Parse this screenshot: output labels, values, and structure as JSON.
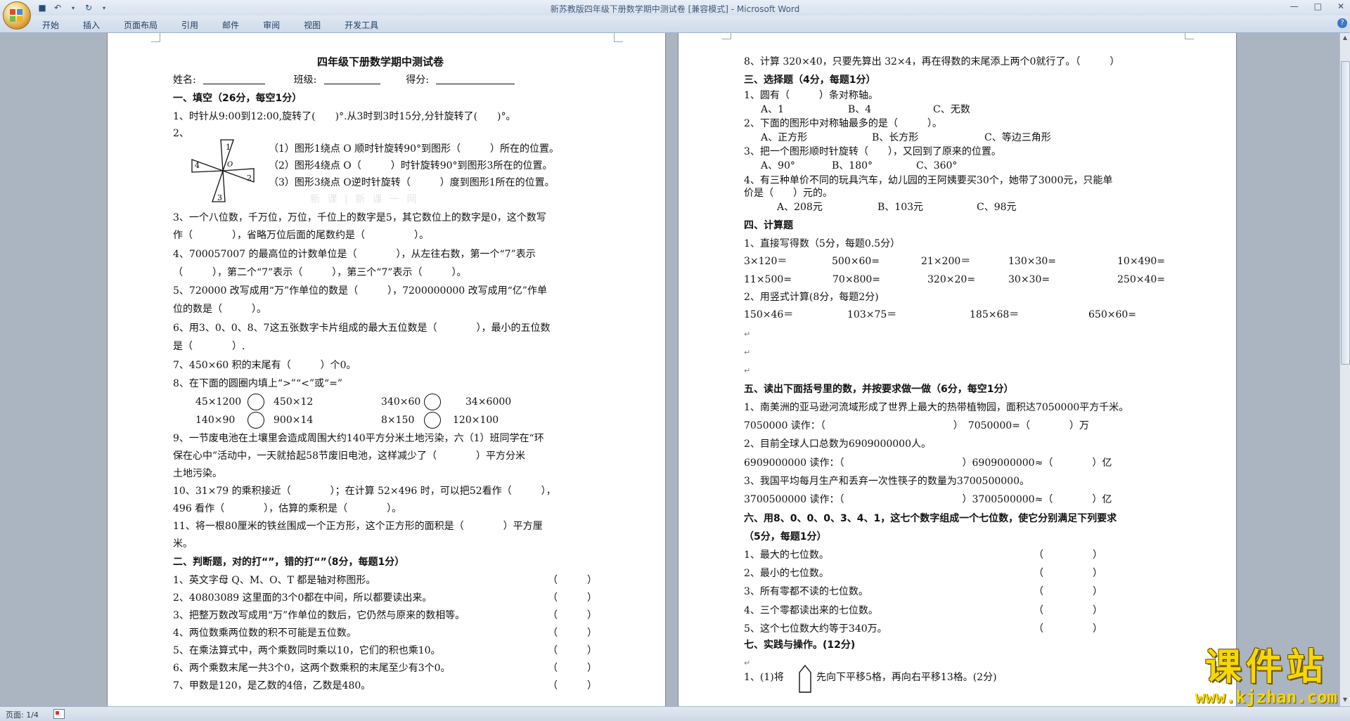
{
  "window": {
    "title": "新苏教版四年级下册数学期中测试卷 [兼容模式] - Microsoft Word",
    "tabs": [
      "开始",
      "插入",
      "页面布局",
      "引用",
      "邮件",
      "审阅",
      "视图",
      "开发工具"
    ]
  },
  "status": {
    "page": "页面: 1/4"
  },
  "left": {
    "title": "四年级下册数学期中测试卷",
    "name_label": "姓名:",
    "class_label": "班级:",
    "score_label": "得分:",
    "sec1": "一、填空（26分，每空1分）",
    "q1": "1、时针从9:00到12:00,旋转了(　　)°.从3时到3时15分,分针旋转了(　　)°。",
    "q2": "2、",
    "q2a": "（1）图形1绕点 O 顺时针旋转90°到图形（　　　）所在的位置。",
    "q2b": "（2）图形4绕点 O（　　　）时针旋转90°到图形3所在的位置。",
    "q2c": "（3）图形3绕点 O逆时针旋转（　　　）度到图形1所在的位置。",
    "fig_labels": [
      "1",
      "2",
      "3",
      "4",
      "O"
    ],
    "q3a": "3、一个八位数，千万位，万位，千位上的数字是5，其它数位上的数字是0，这个数写",
    "q3b": "作（　　　　），省略万位后面的尾数约是（　　　　　）。",
    "q4a": "4、700057007 的最高位的计数单位是（　　　　），从左往右数，第一个“7”表示",
    "q4b": "（　　　），第二个“7”表示（　　　），第三个“7”表示（　　　）。",
    "q5a": "5、720000 改写成用“万”作单位的数是（　　　），7200000000 改写成用“亿”作单",
    "q5b": "位的数是（　　　）。",
    "q6a": "6、用3、0、0、8、7这五张数字卡片组成的最大五位数是（　　　　），最小的五位数",
    "q6b": "是（　　　　）.",
    "q7": "7、450×60 积的末尾有（　　　）个0。",
    "q8": "8、在下面的圆圈内填上“>”“<”或“=”",
    "cmp": [
      "45×1200",
      "450×12",
      "340×60",
      "34×6000",
      "140×90",
      "900×14",
      "8×150",
      "120×100"
    ],
    "q9a": "9、一节废电池在土壤里会造成周围大约140平方分米土地污染，六（1）班同学在“环",
    "q9b": "保在心中”活动中，一天就拾起58节废旧电池，这样减少了（　　　　）平方分米",
    "q9c": "土地污染。",
    "q10a": "10、31×79 的乘积接近（　　　　）；在计算 52×496 时，可以把52看作（　　　），",
    "q10b": "496 看作（　　　　），估算的乘积是（　　　　）。",
    "q11a": "11、将一根80厘米的铁丝围成一个正方形，这个正方形的面积是（　　　　）平方厘",
    "q11b": "米。",
    "sec2": "二、判断题，对的打“”，错的打“”（8分，每题1分）",
    "j1": "1、英文字母 Q、M、O、T 都是轴对称图形。",
    "j2": "2、40803089 这里面的3个0都在中间，所以都要读出来。",
    "j3": "3、把整万数改写成用“万”作单位的数后，它仍然与原来的数相等。",
    "j4": "4、两位数乘两位数的积不可能是五位数。",
    "j5": "5、在乘法算式中，两个乘数同时乘以10，它们的积也乘10。",
    "j6": "6、两个乘数末尾一共3个0，这两个数乘积的末尾至少有3个0。",
    "j7": "7、甲数是120，是乙数的4倍，乙数是480。",
    "paren": "（　　　）",
    "faint": "新 课 | 新 课 一 网"
  },
  "right": {
    "j8": "8、计算 320×40，只要先算出 32×4，再在得数的末尾添上两个0就行了。（　　　）",
    "sec3": "三、选择题（4分，每题1分）",
    "c1": "1、圆有（　　　）条对称轴。",
    "c1o": [
      "A、1",
      "B、4",
      "C、无数"
    ],
    "c2": "2、下面的图形中对称轴最多的是（　　　）。",
    "c2o": [
      "A、正方形",
      "B、长方形",
      "C、等边三角形"
    ],
    "c3": "3、把一个图形顺时针旋转（　　），又回到了原来的位置。",
    "c3o": [
      "A、90°",
      "B、180°",
      "C、360°"
    ],
    "c4a": "4、有三种单价不同的玩具汽车，幼儿园的王阿姨要买30个，她带了3000元，只能单",
    "c4b": "价是（　　）元的。",
    "c4o": [
      "A、208元",
      "B、103元",
      "C、98元"
    ],
    "sec4": "四、计算题",
    "k1": "1、直接写得数（5分，每题0.5分）",
    "calc1": [
      "3×120＝",
      "500×60=",
      "21×200＝",
      "130×30=",
      "10×490="
    ],
    "calc2": [
      "11×500=",
      "70×800=",
      "320×20=",
      "30×30=",
      "250×40="
    ],
    "k2": "2、用竖式计算(8分，每题2分)",
    "calc3": [
      "150×46＝",
      "103×75＝",
      "185×68＝",
      "650×60="
    ],
    "sec5": "五、读出下面括号里的数，并按要求做一做（6分，每空1分）",
    "r1": "1、南美洲的亚马逊河流域形成了世界上最大的热带植物园，面积达7050000平方千米。",
    "r1a": "7050000 读作：（　　　　　　　　　　　　　）　7050000=（　　　　）万",
    "r2": "2、目前全球人口总数为6909000000人。",
    "r2a": "6909000000 读作：（　　　　　　　　　　　　）6909000000≈（　　　　）亿",
    "r3": "3、我国平均每月生产和丢弃一次性筷子的数量为3700500000。",
    "r3a": "3700500000 读作：（　　　　　　　　　　　　）3700500000≈（　　　　）亿",
    "sec6a": "六、用8、0、0、0、3、4、1，这七个数字组成一个七位数，使它分别满足下列要求",
    "sec6b": "（5分，每题1分）",
    "s6": [
      "1、最大的七位数。",
      "2、最小的七位数。",
      "3、所有零都不读的七位数。",
      "4、三个零都读出来的七位数。",
      "5、这个七位数大约等于340万。"
    ],
    "paren": "（　　　　　）",
    "sec7": "七、实践与操作。(12分)",
    "p1a": "1、(1)将",
    "p1b": "先向下平移5格，再向右平移13格。(2分)"
  },
  "watermark": {
    "main": "课件站",
    "url": "www.kjzhan.com"
  }
}
